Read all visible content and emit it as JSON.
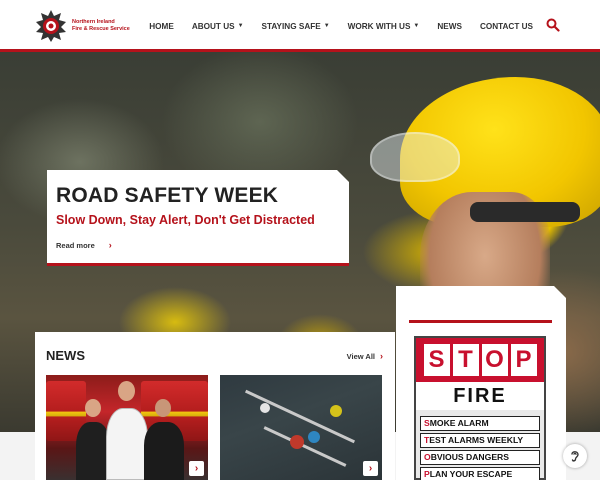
{
  "brand": {
    "logo_line1": "Northern Ireland",
    "logo_line2": "Fire & Rescue Service",
    "accent_color": "#b5121b"
  },
  "nav": {
    "items": [
      {
        "label": "HOME",
        "dropdown": false
      },
      {
        "label": "ABOUT US",
        "dropdown": true
      },
      {
        "label": "STAYING SAFE",
        "dropdown": true
      },
      {
        "label": "WORK WITH US",
        "dropdown": true
      },
      {
        "label": "NEWS",
        "dropdown": false
      },
      {
        "label": "CONTACT US",
        "dropdown": false
      }
    ],
    "search_icon": "search-icon"
  },
  "hero": {
    "title": "ROAD SAFETY WEEK",
    "subtitle": "Slow Down, Stay Alert, Don't Get Distracted",
    "link_label": "Read more"
  },
  "news": {
    "title": "NEWS",
    "view_all": "View All"
  },
  "stop_fire": {
    "letters": [
      "S",
      "T",
      "O",
      "P"
    ],
    "word": "FIRE",
    "lines": [
      {
        "first": "S",
        "rest": "MOKE ALARM"
      },
      {
        "first": "T",
        "rest": "EST ALARMS WEEKLY"
      },
      {
        "first": "O",
        "rest": "BVIOUS DANGERS"
      },
      {
        "first": "P",
        "rest": "LAN YOUR ESCAPE"
      }
    ]
  }
}
